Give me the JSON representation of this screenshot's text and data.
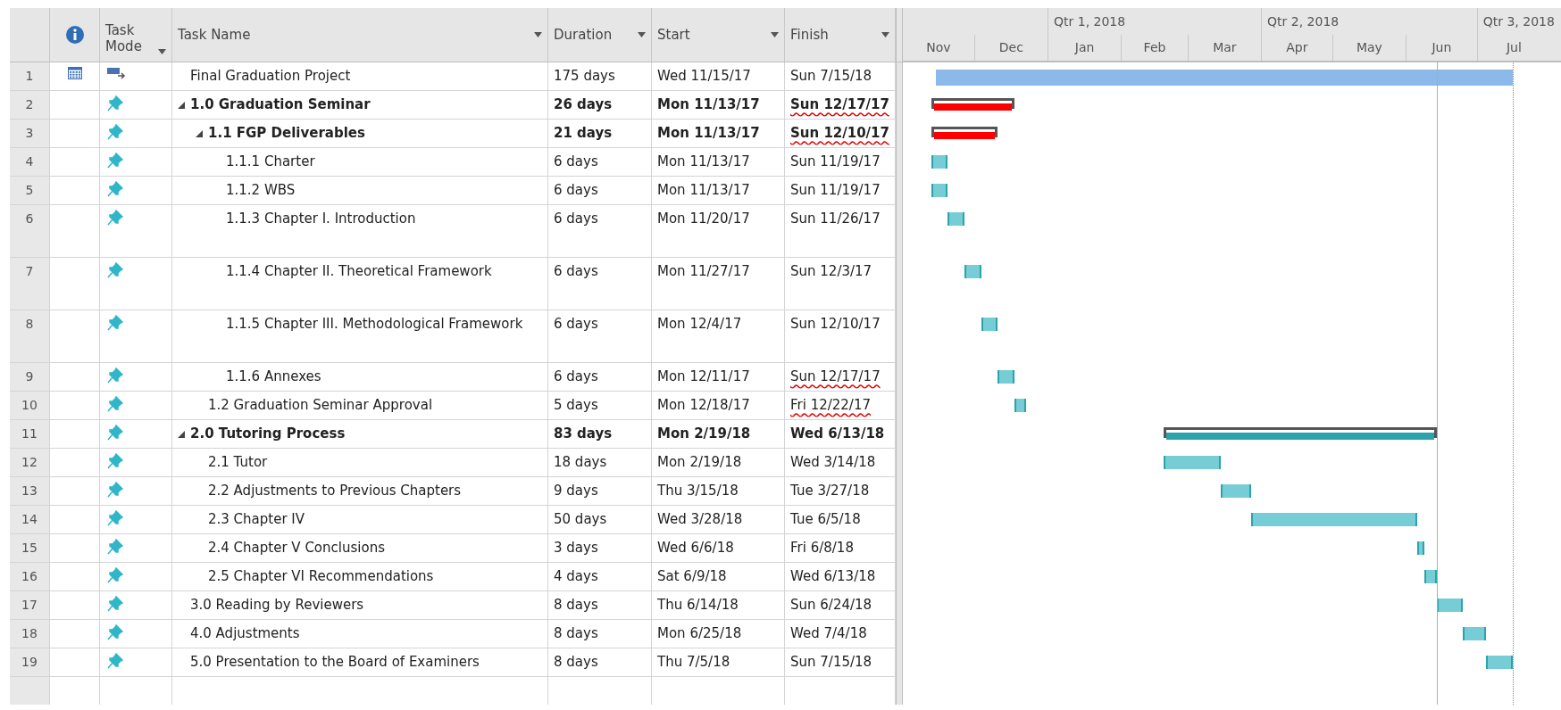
{
  "columns": [
    {
      "kind": "rownum"
    },
    {
      "kind": "info"
    },
    {
      "kind": "mode",
      "label": "Task Mode",
      "filter": true
    },
    {
      "kind": "name",
      "label": "Task Name",
      "filter": true
    },
    {
      "kind": "duration",
      "label": "Duration",
      "filter": true
    },
    {
      "kind": "start",
      "label": "Start",
      "filter": true
    },
    {
      "kind": "finish",
      "label": "Finish",
      "filter": true
    }
  ],
  "timescale": {
    "quarters": [
      "Qtr 1, 2018",
      "Qtr 2, 2018",
      "Qtr 3, 2018"
    ],
    "months": [
      "Nov",
      "Dec",
      "Jan",
      "Feb",
      "Mar",
      "Apr",
      "May",
      "Jun",
      "Jul"
    ]
  },
  "tasks": [
    {
      "number": "1",
      "has_calendar": true,
      "manual": false,
      "name": "Final Graduation Project",
      "duration": "175 days",
      "start": "Wed 11/15/17",
      "finish": "Sun 7/15/18",
      "kind": "task",
      "color": "#8ab9ea",
      "underlined": false,
      "tall": false
    },
    {
      "number": "2",
      "has_calendar": false,
      "manual": true,
      "name": "1.0 Graduation Seminar",
      "duration": "26 days",
      "start": "Mon 11/13/17",
      "finish": "Sun 12/17/17",
      "kind": "summary",
      "color": "#ff0000",
      "underlined": true,
      "tall": false,
      "expanded": true,
      "children": [
        {
          "number": "3",
          "has_calendar": false,
          "manual": true,
          "name": "1.1 FGP Deliverables",
          "duration": "21 days",
          "start": "Mon 11/13/17",
          "finish": "Sun 12/10/17",
          "kind": "summary",
          "color": "#ff0000",
          "underlined": true,
          "tall": false,
          "expanded": true,
          "children": [
            {
              "number": "4",
              "has_calendar": false,
              "manual": true,
              "name": "1.1.1 Charter",
              "duration": "6 days",
              "start": "Mon 11/13/17",
              "finish": "Sun 11/19/17",
              "kind": "task",
              "color": "#77cdd5",
              "underlined": false,
              "tall": false
            },
            {
              "number": "5",
              "has_calendar": false,
              "manual": true,
              "name": "1.1.2 WBS",
              "duration": "6 days",
              "start": "Mon 11/13/17",
              "finish": "Sun 11/19/17",
              "kind": "task",
              "color": "#77cdd5",
              "underlined": false,
              "tall": false
            },
            {
              "number": "6",
              "has_calendar": false,
              "manual": true,
              "name": "1.1.3 Chapter I. Introduction",
              "duration": "6 days",
              "start": "Mon 11/20/17",
              "finish": "Sun 11/26/17",
              "kind": "task",
              "color": "#77cdd5",
              "underlined": false,
              "tall": true
            },
            {
              "number": "7",
              "has_calendar": false,
              "manual": true,
              "name": "1.1.4 Chapter II. Theoretical Framework",
              "duration": "6 days",
              "start": "Mon 11/27/17",
              "finish": "Sun 12/3/17",
              "kind": "task",
              "color": "#77cdd5",
              "underlined": false,
              "tall": true
            },
            {
              "number": "8",
              "has_calendar": false,
              "manual": true,
              "name": "1.1.5 Chapter III. Methodological Framework",
              "duration": "6 days",
              "start": "Mon 12/4/17",
              "finish": "Sun 12/10/17",
              "kind": "task",
              "color": "#77cdd5",
              "underlined": false,
              "tall": true
            },
            {
              "number": "9",
              "has_calendar": false,
              "manual": true,
              "name": "1.1.6 Annexes",
              "duration": "6 days",
              "start": "Mon 12/11/17",
              "finish": "Sun 12/17/17",
              "kind": "task",
              "color": "#77cdd5",
              "underlined": true,
              "tall": false
            }
          ]
        },
        {
          "number": "10",
          "has_calendar": false,
          "manual": true,
          "name": "1.2 Graduation Seminar Approval",
          "duration": "5 days",
          "start": "Mon 12/18/17",
          "finish": "Fri 12/22/17",
          "kind": "task",
          "color": "#77cdd5",
          "underlined": true,
          "tall": false
        }
      ]
    },
    {
      "number": "11",
      "has_calendar": false,
      "manual": true,
      "name": "2.0 Tutoring Process",
      "duration": "83 days",
      "start": "Mon 2/19/18",
      "finish": "Wed 6/13/18",
      "kind": "summary",
      "color": "#2aa3ac",
      "underlined": false,
      "tall": false,
      "expanded": true,
      "children": [
        {
          "number": "12",
          "has_calendar": false,
          "manual": true,
          "name": "2.1 Tutor",
          "duration": "18 days",
          "start": "Mon 2/19/18",
          "finish": "Wed 3/14/18",
          "kind": "task",
          "color": "#77cdd5",
          "underlined": false,
          "tall": false
        },
        {
          "number": "13",
          "has_calendar": false,
          "manual": true,
          "name": "2.2 Adjustments to Previous Chapters",
          "duration": "9 days",
          "start": "Thu 3/15/18",
          "finish": "Tue 3/27/18",
          "kind": "task",
          "color": "#77cdd5",
          "underlined": false,
          "tall": false
        },
        {
          "number": "14",
          "has_calendar": false,
          "manual": true,
          "name": "2.3 Chapter IV",
          "duration": "50 days",
          "start": "Wed 3/28/18",
          "finish": "Tue 6/5/18",
          "kind": "task",
          "color": "#77cdd5",
          "underlined": false,
          "tall": false
        },
        {
          "number": "15",
          "has_calendar": false,
          "manual": true,
          "name": "2.4 Chapter V Conclusions",
          "duration": "3 days",
          "start": "Wed 6/6/18",
          "finish": "Fri 6/8/18",
          "kind": "task",
          "color": "#77cdd5",
          "underlined": false,
          "tall": false
        },
        {
          "number": "16",
          "has_calendar": false,
          "manual": true,
          "name": "2.5 Chapter VI Recommendations",
          "duration": "4 days",
          "start": "Sat 6/9/18",
          "finish": "Wed 6/13/18",
          "kind": "task",
          "color": "#77cdd5",
          "underlined": false,
          "tall": false
        }
      ]
    },
    {
      "number": "17",
      "has_calendar": false,
      "manual": true,
      "name": "3.0 Reading by Reviewers",
      "duration": "8 days",
      "start": "Thu 6/14/18",
      "finish": "Sun 6/24/18",
      "kind": "task",
      "color": "#77cdd5",
      "underlined": false,
      "tall": false
    },
    {
      "number": "18",
      "has_calendar": false,
      "manual": true,
      "name": "4.0 Adjustments",
      "duration": "8 days",
      "start": "Mon 6/25/18",
      "finish": "Wed 7/4/18",
      "kind": "task",
      "color": "#77cdd5",
      "underlined": false,
      "tall": false
    },
    {
      "number": "19",
      "has_calendar": false,
      "manual": true,
      "name": "5.0 Presentation to the Board of Examiners",
      "duration": "8 days",
      "start": "Thu 7/5/18",
      "finish": "Sun 7/15/18",
      "kind": "task",
      "color": "#77cdd5",
      "underlined": false,
      "tall": false
    }
  ]
}
